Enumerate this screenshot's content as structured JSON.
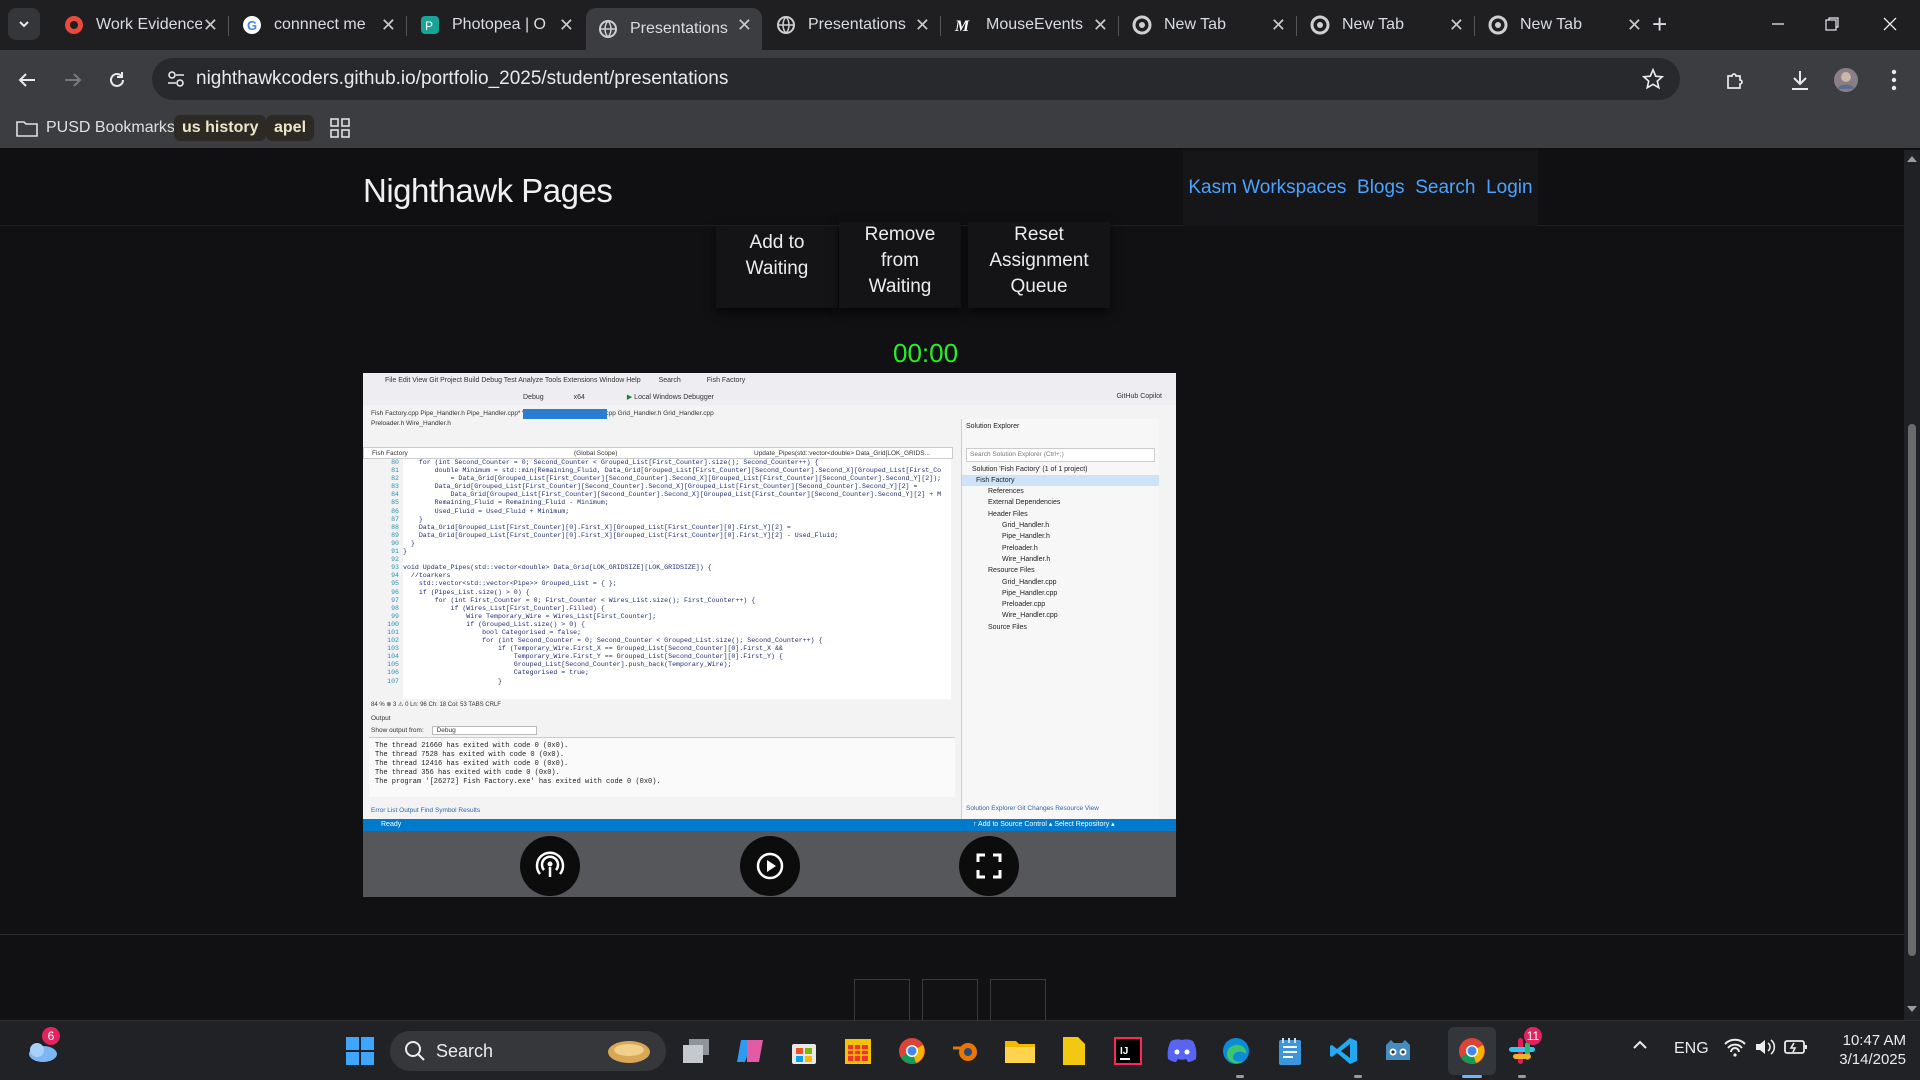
{
  "browser": {
    "tabs": [
      {
        "title": "Work Evidence",
        "icon": "game-icon",
        "color": "#e84a3c"
      },
      {
        "title": "connnect me",
        "icon": "google-icon",
        "color": "#4285f4"
      },
      {
        "title": "Photopea | O",
        "icon": "photopea-icon",
        "color": "#18a497"
      },
      {
        "title": "Presentations",
        "icon": "web-icon",
        "color": "#cfcfcf",
        "active": true
      },
      {
        "title": "Presentations",
        "icon": "web-icon",
        "color": "#cfcfcf"
      },
      {
        "title": "MouseEvents",
        "icon": "mdn-icon",
        "color": "#ffffff"
      },
      {
        "title": "New Tab",
        "icon": "chrome-icon",
        "color": "#cfcfcf"
      },
      {
        "title": "New Tab",
        "icon": "chrome-icon",
        "color": "#cfcfcf"
      },
      {
        "title": "New Tab",
        "icon": "chrome-icon",
        "color": "#cfcfcf"
      }
    ],
    "url": "nighthawkcoders.github.io/portfolio_2025/student/presentations",
    "bookmarks": {
      "folder": "PUSD Bookmarks",
      "chip1": "us history",
      "chip2": "apel"
    }
  },
  "site": {
    "brand": "Nighthawk Pages",
    "nav": [
      "Kasm Workspaces",
      "Blogs",
      "Search",
      "Login"
    ],
    "queue_buttons": [
      {
        "label": "Add to Waiting"
      },
      {
        "label": "Remove from Waiting"
      },
      {
        "label": "Reset Assignment Queue"
      }
    ],
    "timer": "00:00"
  },
  "ide": {
    "menu": "File   Edit   View   Git   Project   Build   Debug   Test   Analyze   Tools   Extensions   Window   Help",
    "search": "Search",
    "solution": "Fish Factory",
    "config": "Debug",
    "platform": "x64",
    "debugger": "Local Windows Debugger",
    "copilot": "GitHub Copilot",
    "tabs": "Fish Factory.cpp    Pipe_Handler.h    Pipe_Handler.cpp*    Wire_Handler.cpp    Preloader.cpp    Grid_Handler.h    Grid_Handler.cpp",
    "tabs2": "Preloader.h    Wire_Handler.h",
    "scope_left": "Fish Factory",
    "scope_mid": "(Global Scope)",
    "scope_right": "Update_Pipes(std::vector<double> Data_Grid[LOK_GRIDS...",
    "line_numbers": "80\n81\n82\n83\n84\n85\n86\n87\n88\n89\n90\n91\n92\n93\n94\n95\n96\n97\n98\n99\n100\n101\n102\n103\n104\n105\n106\n107",
    "code": "    for (int Second_Counter = 0; Second_Counter < Grouped_List[First_Counter].size(); Second_Counter++) {\n        double Minimum = std::min(Remaining_Fluid, Data_Grid[Grouped_List[First_Counter][Second_Counter].Second_X][Grouped_List[First_Co\n            = Data_Grid[Grouped_List[First_Counter][Second_Counter].Second_X][Grouped_List[First_Counter][Second_Counter].Second_Y][2]);\n        Data_Grid[Grouped_List[First_Counter][Second_Counter].Second_X][Grouped_List[First_Counter][Second_Counter].Second_Y][2] =\n            Data_Grid[Grouped_List[First_Counter][Second_Counter].Second_X][Grouped_List[First_Counter][Second_Counter].Second_Y][2] + M\n        Remaining_Fluid = Remaining_Fluid - Minimum;\n        Used_Fluid = Used_Fluid + Minimum;\n    }\n    Data_Grid[Grouped_List[First_Counter][0].First_X][Grouped_List[First_Counter][0].First_Y][2] =\n    Data_Grid[Grouped_List[First_Counter][0].First_X][Grouped_List[First_Counter][0].First_Y][2] - Used_Fluid;\n  }\n}\n\nvoid Update_Pipes(std::vector<double> Data_Grid[LOK_GRIDSIZE][LOK_GRIDSIZE]) {\n  //toarkers\n    std::vector<std::vector<Pipe>> Grouped_List = { };\n    if (Pipes_List.size() > 0) {\n        for (int First_Counter = 0; First_Counter < Wires_List.size(); First_Counter++) {\n            if (Wires_List[First_Counter].Filled) {\n                Wire Temporary_Wire = Wires_List[First_Counter];\n                if (Grouped_List.size() > 0) {\n                    bool Categorised = false;\n                    for (int Second_Counter = 0; Second_Counter < Grouped_List.size(); Second_Counter++) {\n                        if (Temporary_Wire.First_X == Grouped_List[Second_Counter][0].First_X &&\n                            Temporary_Wire.First_Y == Grouped_List[Second_Counter][0].First_Y) {\n                            Grouped_List[Second_Counter].push_back(Temporary_Wire);\n                            Categorised = true;\n                        }",
    "editor_status": "84 %      ⊗ 3    ⚠ 0        Ln: 96    Ch: 18    Col: 53    TABS    CRLF",
    "output_title": "Output",
    "output_from": "Show output from:",
    "output_source": "Debug",
    "output": "The thread 21660 has exited with code 0 (0x0).\nThe thread 7528 has exited with code 0 (0x0).\nThe thread 12416 has exited with code 0 (0x0).\nThe thread 356 has exited with code 0 (0x0).\nThe program '[26272] Fish Factory.exe' has exited with code 0 (0x0).",
    "bottom_tabs": "Error List    Output    Find Symbol Results",
    "solution_explorer": "Solution Explorer",
    "sol_search": "Search Solution Explorer (Ctrl+;)",
    "tree": [
      "Solution 'Fish Factory' (1 of 1 project)",
      "Fish Factory",
      "References",
      "External Dependencies",
      "Header Files",
      "Grid_Handler.h",
      "Pipe_Handler.h",
      "Preloader.h",
      "Wire_Handler.h",
      "Resource Files",
      "Grid_Handler.cpp",
      "Pipe_Handler.cpp",
      "Preloader.cpp",
      "Wire_Handler.cpp",
      "Source Files"
    ],
    "sol_tabs": "Solution Explorer    Git Changes    Resource View",
    "status": "Ready",
    "status_right": "↑ Add to Source Control ▴      Select Repository ▴"
  },
  "taskbar": {
    "weather_badge": "6",
    "search": "Search",
    "teams_badge": "11",
    "lang": "ENG",
    "time": "10:47 AM",
    "date": "3/14/2025"
  }
}
